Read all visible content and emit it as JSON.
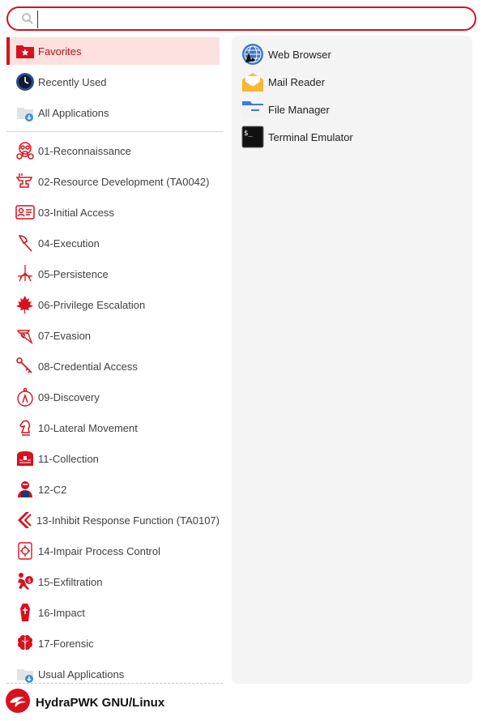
{
  "search": {
    "value": "",
    "placeholder": ""
  },
  "categories": [
    {
      "label": "Favorites",
      "icon": "favorites-folder-icon"
    },
    {
      "label": "Recently Used",
      "icon": "clock-icon"
    },
    {
      "label": "All Applications",
      "icon": "all-applications-icon"
    },
    {
      "label": "01-Reconnaissance",
      "icon": "gas-mask-icon"
    },
    {
      "label": "02-Resource Development (TA0042)",
      "icon": "anvil-icon"
    },
    {
      "label": "03-Initial Access",
      "icon": "id-card-icon"
    },
    {
      "label": "04-Execution",
      "icon": "axe-icon"
    },
    {
      "label": "05-Persistence",
      "icon": "roots-icon"
    },
    {
      "label": "06-Privilege Escalation",
      "icon": "maple-leaf-icon"
    },
    {
      "label": "07-Evasion",
      "icon": "plague-doctor-icon"
    },
    {
      "label": "08-Credential Access",
      "icon": "key-icon"
    },
    {
      "label": "09-Discovery",
      "icon": "compass-icon"
    },
    {
      "label": "10-Lateral Movement",
      "icon": "chess-knight-icon"
    },
    {
      "label": "11-Collection",
      "icon": "treasure-chest-icon"
    },
    {
      "label": "12-C2",
      "icon": "hacker-icon"
    },
    {
      "label": "13-Inhibit Response Function (TA0107)",
      "icon": "inhibit-icon"
    },
    {
      "label": "14-Impair Process Control",
      "icon": "process-control-icon"
    },
    {
      "label": "15-Exfiltration",
      "icon": "thief-icon"
    },
    {
      "label": "16-Impact",
      "icon": "coffin-icon"
    },
    {
      "label": "17-Forensic",
      "icon": "brain-icon"
    },
    {
      "label": "Usual Applications",
      "icon": "usual-applications-icon"
    }
  ],
  "apps": [
    {
      "label": "Web Browser",
      "icon": "web-browser-icon"
    },
    {
      "label": "Mail Reader",
      "icon": "mail-reader-icon"
    },
    {
      "label": "File Manager",
      "icon": "file-manager-icon"
    },
    {
      "label": "Terminal Emulator",
      "icon": "terminal-icon"
    }
  ],
  "footer": {
    "label": "HydraPWK GNU/Linux",
    "icon": "hydrapwk-logo-icon"
  },
  "colors": {
    "accent": "#d8111f",
    "selected_bg": "#fde0e0",
    "panel_bg": "#f4f4f4"
  }
}
